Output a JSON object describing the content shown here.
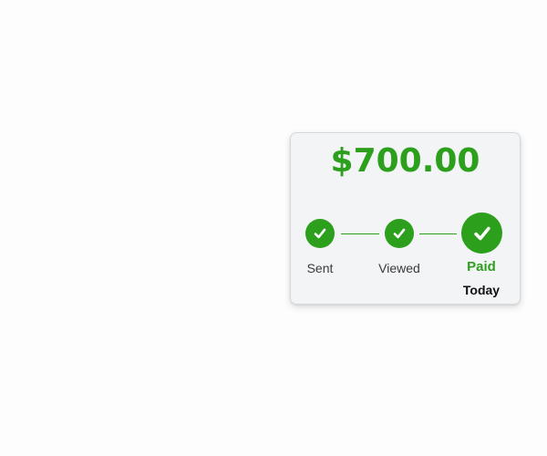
{
  "payment_card": {
    "amount": "$700.00",
    "steps": [
      {
        "label": "Sent",
        "completed": true,
        "icon": "checkmark-icon"
      },
      {
        "label": "Viewed",
        "completed": true,
        "icon": "checkmark-icon"
      },
      {
        "label": "Paid",
        "completed": true,
        "icon": "checkmark-icon",
        "current": true
      }
    ],
    "paid_date": "Today"
  },
  "colors": {
    "accent_green": "#2ca01c",
    "card_background": "#f2f4f6",
    "label_gray": "#393a3d"
  }
}
